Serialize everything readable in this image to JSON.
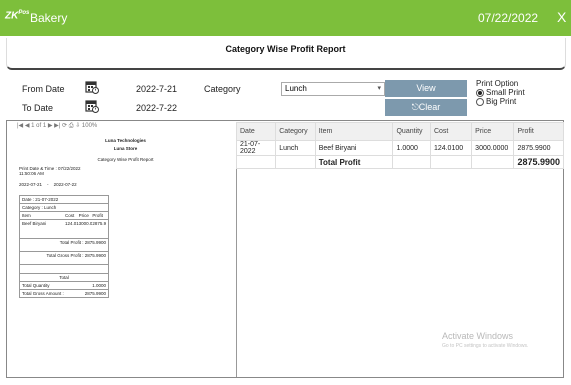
{
  "titlebar": {
    "brand": "ZK",
    "brand_sup": "Pos",
    "app_title": "Bakery",
    "date": "07/22/2022",
    "close": "X"
  },
  "report_title": "Category Wise Profit Report",
  "filters": {
    "from_label": "From Date",
    "from_value": "2022-7-21",
    "to_label": "To Date",
    "to_value": "2022-7-22",
    "category_label": "Category",
    "category_value": "Lunch"
  },
  "buttons": {
    "view": "View",
    "clear": "Clear"
  },
  "print_options": {
    "label": "Print Option",
    "small": "Small Print",
    "big": "Big Print",
    "selected": "small"
  },
  "preview": {
    "toolbar_page": "of 1",
    "toolbar_zoom": "100%",
    "company": "Luna Technologies",
    "store": "Luna Store",
    "report_name": "Category Wise Profit Report",
    "print_dt": "Print Date & Time : 07/22/2022",
    "print_time": "11:50:06 AM",
    "range_from": "2022-07-21",
    "range_sep": "-",
    "range_to": "2022-07-22",
    "date_line": "Date : 21-07-2022",
    "category_line": "Category : Lunch",
    "cols": [
      "Item",
      "Cost",
      "Price",
      "Profit"
    ],
    "item": "Beef Biryani",
    "item_cost": "124.0100",
    "item_price": "3000.0000",
    "item_profit": "2875.9900",
    "total_profit_label": "Total Profit :",
    "total_profit_value": "2875.9900",
    "total_gross_label": "Total Gross Profit :",
    "total_gross_value": "2875.9900",
    "total_label": "Total",
    "total_qty_label": "Total Quantity",
    "total_qty_value": "1.0000",
    "total_gross_amount_label": "Total Gross Amount :",
    "total_gross_amount_value": "2875.9900"
  },
  "grid": {
    "columns": [
      "Date",
      "Category",
      "Item",
      "Quantity",
      "Cost",
      "Price",
      "Profit"
    ],
    "rows": [
      [
        "21-07-2022",
        "Lunch",
        "Beef Biryani",
        "1.0000",
        "124.0100",
        "3000.0000",
        "2875.9900"
      ]
    ],
    "total_label": "Total Profit",
    "total_value": "2875.9900"
  },
  "watermark": {
    "title": "Activate Windows",
    "sub": "Go to PC settings to activate Windows."
  }
}
